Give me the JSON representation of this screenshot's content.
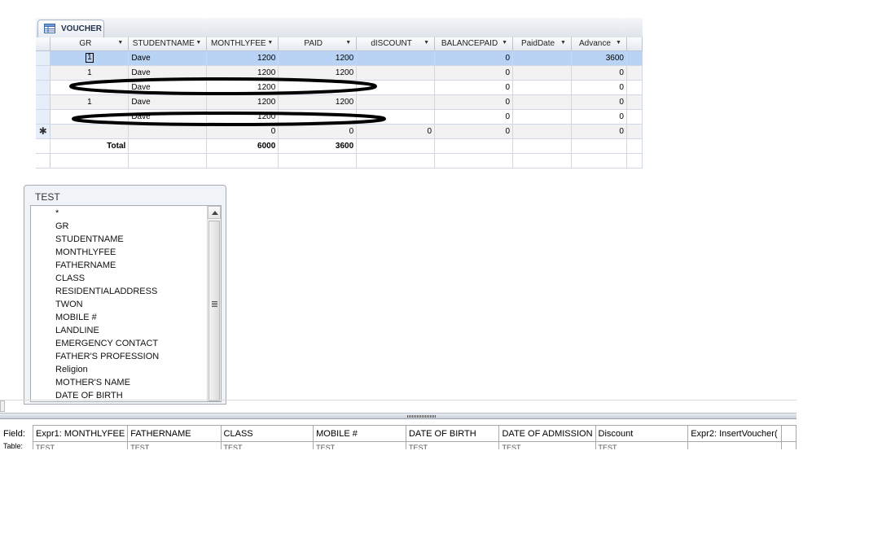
{
  "datasheet": {
    "tab_title": "VOUCHER",
    "columns": [
      "GR",
      "STUDENTNAME",
      "MONTHLYFEE",
      "PAID",
      "dISCOUNT",
      "BALANCEPAID",
      "PaidDate",
      "Advance"
    ],
    "rows": [
      {
        "gr": "1",
        "studentname": "Dave",
        "monthlyfee": "1200",
        "paid": "1200",
        "discount": "",
        "balancepaid": "0",
        "paiddate": "",
        "advance": "3600"
      },
      {
        "gr": "1",
        "studentname": "Dave",
        "monthlyfee": "1200",
        "paid": "1200",
        "discount": "",
        "balancepaid": "0",
        "paiddate": "",
        "advance": "0"
      },
      {
        "gr": "",
        "studentname": "Dave",
        "monthlyfee": "1200",
        "paid": "",
        "discount": "",
        "balancepaid": "0",
        "paiddate": "",
        "advance": "0"
      },
      {
        "gr": "1",
        "studentname": "Dave",
        "monthlyfee": "1200",
        "paid": "1200",
        "discount": "",
        "balancepaid": "0",
        "paiddate": "",
        "advance": "0"
      },
      {
        "gr": "",
        "studentname": "Dave",
        "monthlyfee": "1200",
        "paid": "",
        "discount": "",
        "balancepaid": "0",
        "paiddate": "",
        "advance": "0"
      }
    ],
    "new_row": {
      "marker": "✱",
      "monthlyfee": "0",
      "paid": "0",
      "discount": "0",
      "balancepaid": "0",
      "advance": "0"
    },
    "total_row": {
      "label": "Total",
      "monthlyfee": "6000",
      "paid": "3600"
    }
  },
  "field_list": {
    "title": "TEST",
    "fields": [
      "*",
      "GR",
      "STUDENTNAME",
      "MONTHLYFEE",
      "FATHERNAME",
      "CLASS",
      "RESIDENTIALADDRESS",
      "TWON",
      "MOBILE #",
      "LANDLINE",
      "EMERGENCY CONTACT",
      "FATHER'S PROFESSION",
      "Religion",
      "MOTHER'S NAME",
      "DATE OF BIRTH"
    ]
  },
  "design_grid": {
    "field_label": "Field:",
    "table_label": "Table:",
    "fields": [
      "Expr1: MONTHLYFEE",
      "FATHERNAME",
      "CLASS",
      "MOBILE #",
      "DATE OF BIRTH",
      "DATE OF ADMISSION",
      "Discount",
      "Expr2: InsertVoucher(",
      ""
    ],
    "tables": [
      "TEST",
      "TEST",
      "TEST",
      "TEST",
      "TEST",
      "TEST",
      "TEST",
      "",
      ""
    ]
  },
  "colors": {
    "active_row": "#b8d3f4",
    "alt_row": "#f2f2f2",
    "grid_line": "#d0d7e5"
  }
}
